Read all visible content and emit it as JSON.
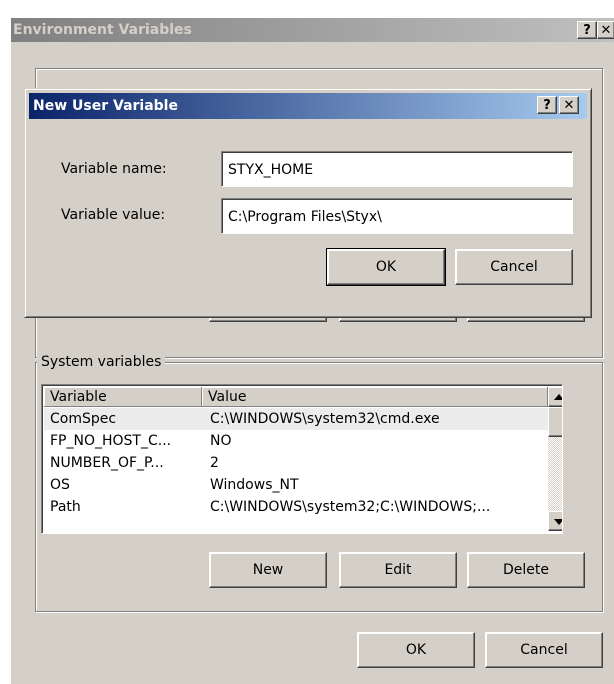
{
  "outer_dialog": {
    "title": "Environment Variables",
    "help_label": "?",
    "close_label": "✕",
    "ok_label": "OK",
    "cancel_label": "Cancel"
  },
  "new_user_variable_dialog": {
    "title": "New User Variable",
    "help_label": "?",
    "close_label": "✕",
    "name_label": "Variable name:",
    "name_value": "STYX_HOME",
    "value_label": "Variable value:",
    "value_value": "C:\\Program Files\\Styx\\",
    "ok_label": "OK",
    "cancel_label": "Cancel"
  },
  "system_variables": {
    "legend": "System variables",
    "columns": [
      "Variable",
      "Value"
    ],
    "rows": [
      {
        "name": "ComSpec",
        "value": "C:\\WINDOWS\\system32\\cmd.exe"
      },
      {
        "name": "FP_NO_HOST_C...",
        "value": "NO"
      },
      {
        "name": "NUMBER_OF_P...",
        "value": "2"
      },
      {
        "name": "OS",
        "value": "Windows_NT"
      },
      {
        "name": "Path",
        "value": "C:\\WINDOWS\\system32;C:\\WINDOWS;..."
      }
    ],
    "new_label": "New",
    "edit_label": "Edit",
    "delete_label": "Delete"
  },
  "icons": {
    "scroll_up": "triangle-up-icon",
    "scroll_down": "triangle-down-icon"
  },
  "colors": {
    "active_titlebar": "#0a246a",
    "inactive_titlebar": "#808080",
    "dialog_face": "#d4d0c8"
  }
}
